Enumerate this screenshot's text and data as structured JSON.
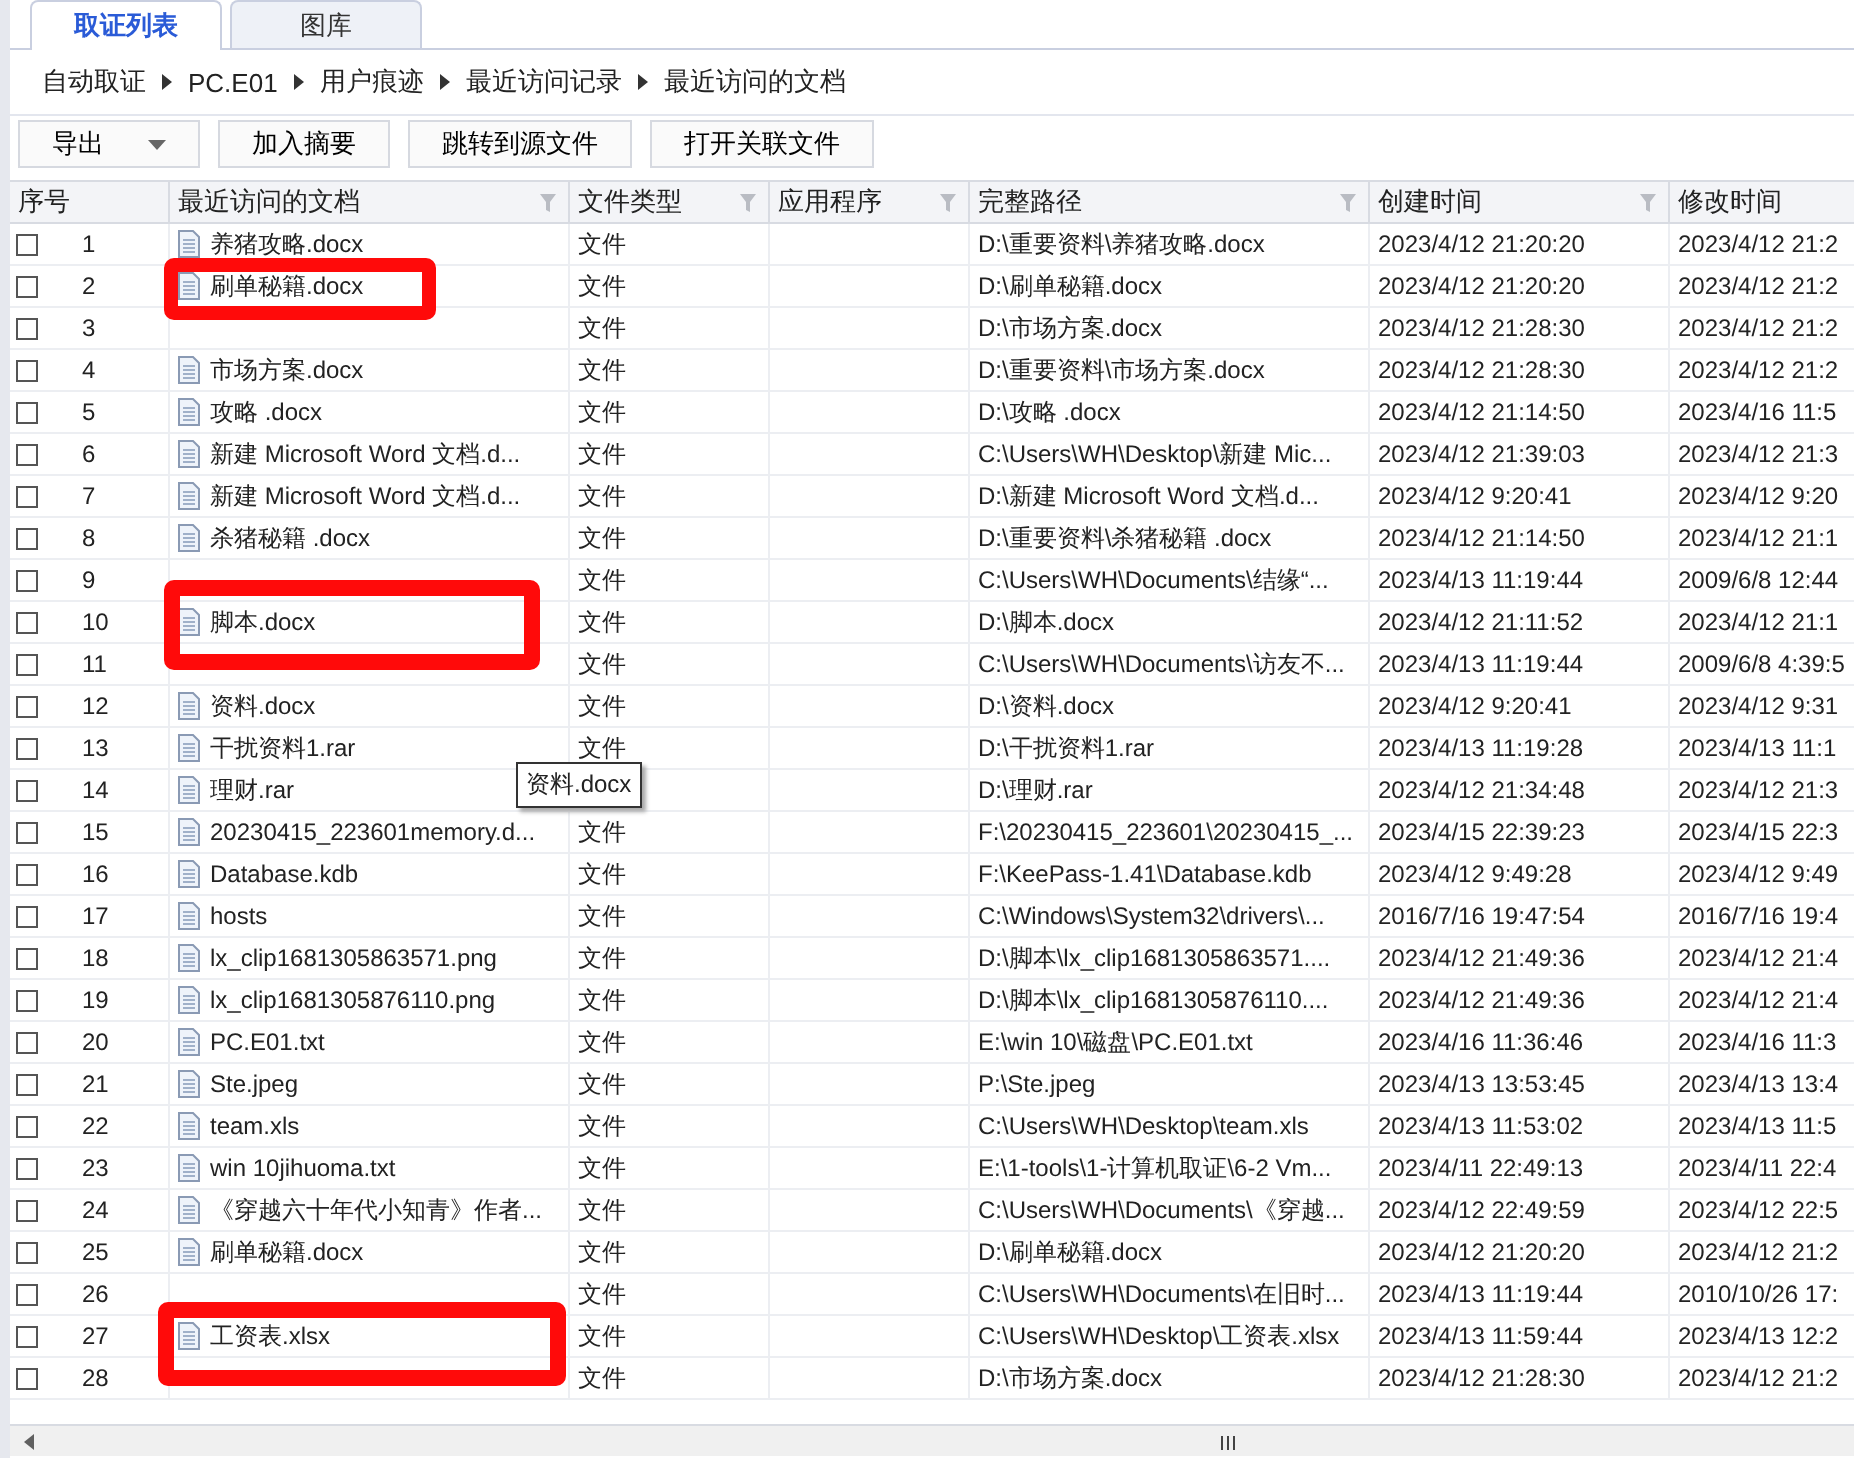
{
  "tabs": [
    {
      "label": "取证列表",
      "selected": true
    },
    {
      "label": "图库",
      "selected": false
    }
  ],
  "breadcrumb": [
    "自动取证",
    "PC.E01",
    "用户痕迹",
    "最近访问记录",
    "最近访问的文档"
  ],
  "toolbar": [
    {
      "label": "导出",
      "kind": "dropdown"
    },
    {
      "label": "加入摘要",
      "kind": "button"
    },
    {
      "label": "跳转到源文件",
      "kind": "button"
    },
    {
      "label": "打开关联文件",
      "kind": "button"
    }
  ],
  "table": {
    "columns": [
      {
        "label": "序号"
      },
      {
        "label": "最近访问的文档",
        "filter": true
      },
      {
        "label": "文件类型",
        "filter": true
      },
      {
        "label": "应用程序",
        "filter": true
      },
      {
        "label": "完整路径",
        "filter": true
      },
      {
        "label": "创建时间",
        "filter": true
      },
      {
        "label": "修改时间"
      }
    ],
    "rows": [
      {
        "checked": false,
        "index": "1",
        "name": "养猪攻略.docx",
        "type": "文件",
        "path": "D:\\重要资料\\养猪攻略.docx",
        "created": "2023/4/12 21:20:20",
        "modified": "2023/4/12 21:2"
      },
      {
        "checked": false,
        "index": "2",
        "name": "刷单秘籍.docx",
        "type": "文件",
        "path": "D:\\刷单秘籍.docx",
        "created": "2023/4/12 21:20:20",
        "modified": "2023/4/12 21:2"
      },
      {
        "checked": false,
        "index": "3",
        "type": "文件",
        "path": "D:\\市场方案.docx",
        "created": "2023/4/12 21:28:30",
        "modified": "2023/4/12 21:2"
      },
      {
        "checked": false,
        "index": "4",
        "name": "市场方案.docx",
        "type": "文件",
        "path": "D:\\重要资料\\市场方案.docx",
        "created": "2023/4/12 21:28:30",
        "modified": "2023/4/12 21:2"
      },
      {
        "checked": false,
        "index": "5",
        "name": "攻略 .docx",
        "type": "文件",
        "path": "D:\\攻略 .docx",
        "created": "2023/4/12 21:14:50",
        "modified": "2023/4/16 11:5"
      },
      {
        "checked": false,
        "index": "6",
        "name": "新建 Microsoft Word 文档.d...",
        "type": "文件",
        "path": "C:\\Users\\WH\\Desktop\\新建 Mic...",
        "created": "2023/4/12 21:39:03",
        "modified": "2023/4/12 21:3"
      },
      {
        "checked": false,
        "index": "7",
        "name": "新建 Microsoft Word 文档.d...",
        "type": "文件",
        "path": "D:\\新建 Microsoft Word 文档.d...",
        "created": "2023/4/12 9:20:41",
        "modified": "2023/4/12 9:20"
      },
      {
        "checked": false,
        "index": "8",
        "name": "杀猪秘籍 .docx",
        "type": "文件",
        "path": "D:\\重要资料\\杀猪秘籍 .docx",
        "created": "2023/4/12 21:14:50",
        "modified": "2023/4/12 21:1"
      },
      {
        "checked": false,
        "index": "9",
        "type": "文件",
        "path": "C:\\Users\\WH\\Documents\\结缘“...",
        "created": "2023/4/13 11:19:44",
        "modified": "2009/6/8 12:44"
      },
      {
        "checked": false,
        "index": "10",
        "name": "脚本.docx",
        "type": "文件",
        "path": "D:\\脚本.docx",
        "created": "2023/4/12 21:11:52",
        "modified": "2023/4/12 21:1"
      },
      {
        "checked": false,
        "index": "11",
        "type": "文件",
        "path": "C:\\Users\\WH\\Documents\\访友不...",
        "created": "2023/4/13 11:19:44",
        "modified": "2009/6/8 4:39:5"
      },
      {
        "checked": false,
        "index": "12",
        "name": "资料.docx",
        "type": "文件",
        "path": "D:\\资料.docx",
        "created": "2023/4/12 9:20:41",
        "modified": "2023/4/12 9:31"
      },
      {
        "checked": false,
        "index": "13",
        "name": "干扰资料1.rar",
        "type": "文件",
        "path": "D:\\干扰资料1.rar",
        "created": "2023/4/13 11:19:28",
        "modified": "2023/4/13 11:1"
      },
      {
        "checked": false,
        "index": "14",
        "name": "理财.rar",
        "path": "D:\\理财.rar",
        "created": "2023/4/12 21:34:48",
        "modified": "2023/4/12 21:3"
      },
      {
        "checked": false,
        "index": "15",
        "name": "20230415_223601memory.d...",
        "type": "文件",
        "path": "F:\\20230415_223601\\20230415_...",
        "created": "2023/4/15 22:39:23",
        "modified": "2023/4/15 22:3"
      },
      {
        "checked": false,
        "index": "16",
        "name": "Database.kdb",
        "type": "文件",
        "path": "F:\\KeePass-1.41\\Database.kdb",
        "created": "2023/4/12 9:49:28",
        "modified": "2023/4/12 9:49"
      },
      {
        "checked": false,
        "index": "17",
        "name": "hosts",
        "type": "文件",
        "path": "C:\\Windows\\System32\\drivers\\...",
        "created": "2016/7/16 19:47:54",
        "modified": "2016/7/16 19:4"
      },
      {
        "checked": false,
        "index": "18",
        "name": "lx_clip1681305863571.png",
        "type": "文件",
        "path": "D:\\脚本\\lx_clip1681305863571....",
        "created": "2023/4/12 21:49:36",
        "modified": "2023/4/12 21:4"
      },
      {
        "checked": false,
        "index": "19",
        "name": "lx_clip1681305876110.png",
        "type": "文件",
        "path": "D:\\脚本\\lx_clip1681305876110....",
        "created": "2023/4/12 21:49:36",
        "modified": "2023/4/12 21:4"
      },
      {
        "checked": false,
        "index": "20",
        "name": "PC.E01.txt",
        "type": "文件",
        "path": "E:\\win 10\\磁盘\\PC.E01.txt",
        "created": "2023/4/16 11:36:46",
        "modified": "2023/4/16 11:3"
      },
      {
        "checked": false,
        "index": "21",
        "name": "Ste.jpeg",
        "type": "文件",
        "path": "P:\\Ste.jpeg",
        "created": "2023/4/13 13:53:45",
        "modified": "2023/4/13 13:4"
      },
      {
        "checked": false,
        "index": "22",
        "name": "team.xls",
        "type": "文件",
        "path": "C:\\Users\\WH\\Desktop\\team.xls",
        "created": "2023/4/13 11:53:02",
        "modified": "2023/4/13 11:5"
      },
      {
        "checked": false,
        "index": "23",
        "name": "win 10jihuoma.txt",
        "type": "文件",
        "path": "E:\\1-tools\\1-计算机取证\\6-2 Vm...",
        "created": "2023/4/11 22:49:13",
        "modified": "2023/4/11 22:4"
      },
      {
        "checked": false,
        "index": "24",
        "name": "《穿越六十年代小知青》作者...",
        "type": "文件",
        "path": "C:\\Users\\WH\\Documents\\《穿越...",
        "created": "2023/4/12 22:49:59",
        "modified": "2023/4/12 22:5"
      },
      {
        "checked": false,
        "index": "25",
        "name": "刷单秘籍.docx",
        "type": "文件",
        "path": "D:\\刷单秘籍.docx",
        "created": "2023/4/12 21:20:20",
        "modified": "2023/4/12 21:2"
      },
      {
        "checked": false,
        "index": "26",
        "type": "文件",
        "path": "C:\\Users\\WH\\Documents\\在旧时...",
        "created": "2023/4/13 11:19:44",
        "modified": "2010/10/26 17:"
      },
      {
        "checked": false,
        "index": "27",
        "name": "工资表.xlsx",
        "type": "文件",
        "path": "C:\\Users\\WH\\Desktop\\工资表.xlsx",
        "created": "2023/4/13 11:59:44",
        "modified": "2023/4/13 12:2"
      },
      {
        "checked": false,
        "index": "28",
        "type": "文件",
        "path": "D:\\市场方案.docx",
        "created": "2023/4/12 21:28:30",
        "modified": "2023/4/12 21:2"
      }
    ]
  },
  "tooltip": "资料.docx"
}
